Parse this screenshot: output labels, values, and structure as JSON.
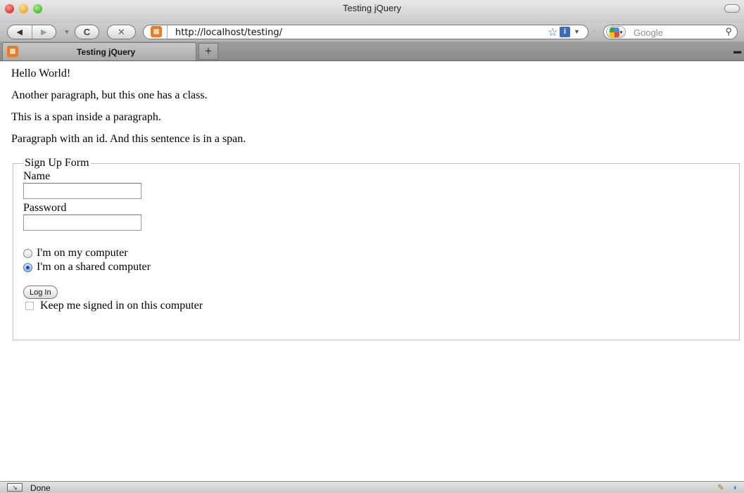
{
  "window": {
    "title": "Testing jQuery"
  },
  "toolbar": {
    "back_icon": "◀",
    "forward_icon": "▶",
    "reload_icon": "C",
    "stop_icon": "✕",
    "url": "http://localhost/testing/",
    "search_placeholder": "Google"
  },
  "tabs": [
    {
      "label": "Testing jQuery"
    }
  ],
  "page": {
    "paragraphs": [
      "Hello World!",
      "Another paragraph, but this one has a class.",
      "This is a span inside a paragraph.",
      "Paragraph with an id. And this sentence is in a span."
    ],
    "form": {
      "legend": "Sign Up Form",
      "name_label": "Name",
      "name_value": "",
      "password_label": "Password",
      "password_value": "",
      "radio_options": [
        {
          "label": "I'm on my computer",
          "checked": false
        },
        {
          "label": "I'm on a shared computer",
          "checked": true
        }
      ],
      "submit_label": "Log In",
      "remember_label": "Keep me signed in on this computer",
      "remember_checked": false
    }
  },
  "status": {
    "text": "Done"
  },
  "colors": {
    "favicon": "#ee7a1d",
    "accent": "#3b6bc2"
  }
}
